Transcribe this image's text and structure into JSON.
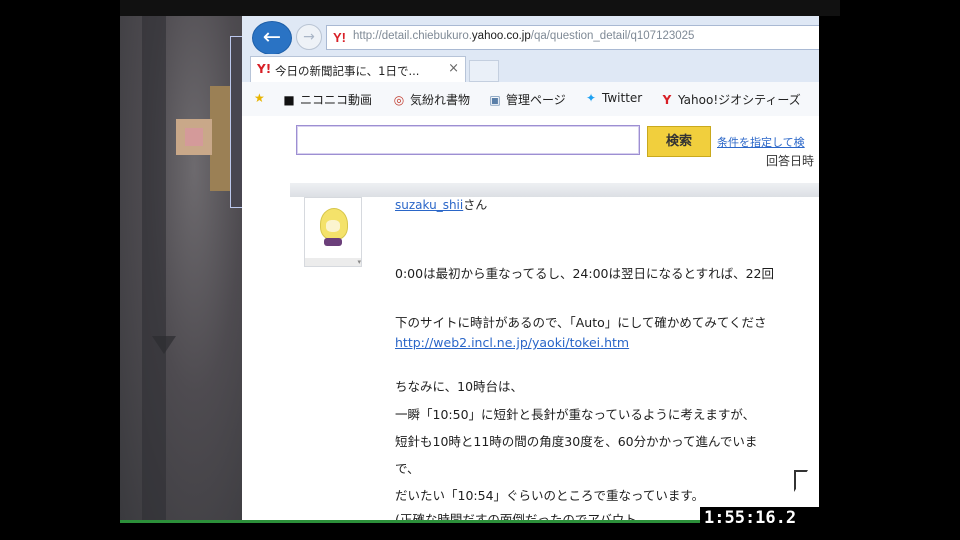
{
  "browser": {
    "address_bar": {
      "url_prefix": "http://detail.chiebukuro.",
      "url_domain": "yahoo.co.jp",
      "url_suffix": "/qa/question_detail/q107123025",
      "favicon": "yahoo-y-icon",
      "back_icon": "arrow-left-icon",
      "forward_icon": "arrow-right-icon"
    },
    "tab": {
      "label": "今日の新聞記事に、1日で...",
      "close": "×"
    },
    "favorites": [
      {
        "icon": "star-icon",
        "glyph": "★",
        "label": ""
      },
      {
        "icon": "niconico-icon",
        "glyph": "■",
        "label": "ニコニコ動画"
      },
      {
        "icon": "kimagure-icon",
        "glyph": "◎",
        "label": "気紛れ書物"
      },
      {
        "icon": "page-icon",
        "glyph": "▣",
        "label": "管理ページ"
      },
      {
        "icon": "twitter-icon",
        "glyph": "✦",
        "label": "Twitter"
      },
      {
        "icon": "yahoo-icon",
        "glyph": "Y",
        "label": "Yahoo!ジオシティーズ"
      }
    ]
  },
  "search": {
    "input_value": "",
    "button_label": "検索",
    "advanced_link": "条件を指定して検"
  },
  "answer": {
    "date_label": "回答日時",
    "username": "suzaku_shii",
    "username_suffix": "さん",
    "lines": [
      "0:00は最初から重なってるし、24:00は翌日になるとすれば、22回",
      "下のサイトに時計があるので、「Auto」にして確かめてみてくださ",
      "http://web2.incl.ne.jp/yaoki/tokei.htm",
      "ちなみに、10時台は、",
      "一瞬「10:50」に短針と長針が重なっているように考えますが、",
      "短針も10時と11時の間の角度30度を、60分かかって進んでいま",
      "で、",
      "だいたい「10:54」ぐらいのところで重なっています。",
      "(正確な時間だすの面倒だったのでアバウト"
    ]
  },
  "overlay": {
    "timestamp": "1:55:16.2"
  },
  "colors": {
    "back_button": "#2a73c4",
    "search_button": "#f1cf3d",
    "link": "#2a66c8",
    "yahoo_red": "#d81f26"
  }
}
